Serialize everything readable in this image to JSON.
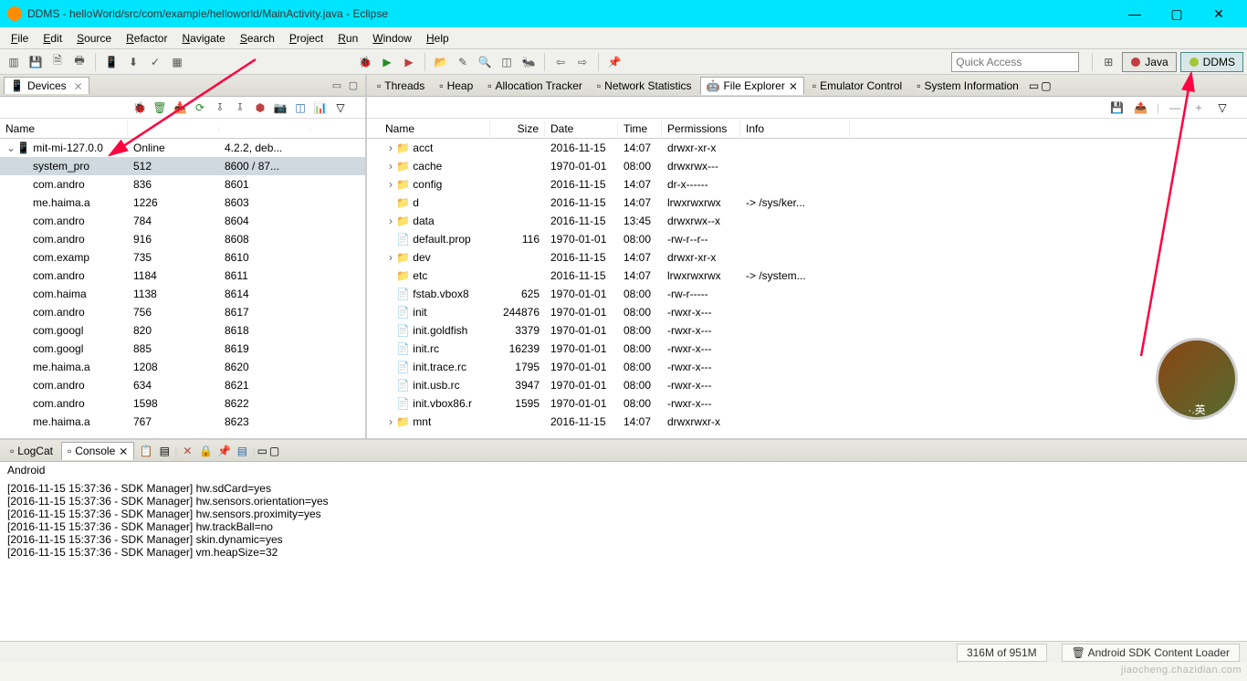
{
  "title": "DDMS - helloWorld/src/com/example/helloworld/MainActivity.java - Eclipse",
  "menus": [
    "File",
    "Edit",
    "Source",
    "Refactor",
    "Navigate",
    "Search",
    "Project",
    "Run",
    "Window",
    "Help"
  ],
  "quick_access_placeholder": "Quick Access",
  "perspectives": {
    "java": "Java",
    "ddms": "DDMS"
  },
  "devices": {
    "tab_label": "Devices",
    "header_name": "Name",
    "root": {
      "name": "mit-mi-127.0.0",
      "status": "Online",
      "version": "4.2.2, deb..."
    },
    "rows": [
      {
        "name": "system_pro",
        "pid": "512",
        "port": "8600 / 87...",
        "sel": true
      },
      {
        "name": "com.andro",
        "pid": "836",
        "port": "8601"
      },
      {
        "name": "me.haima.a",
        "pid": "1226",
        "port": "8603"
      },
      {
        "name": "com.andro",
        "pid": "784",
        "port": "8604"
      },
      {
        "name": "com.andro",
        "pid": "916",
        "port": "8608"
      },
      {
        "name": "com.examp",
        "pid": "735",
        "port": "8610"
      },
      {
        "name": "com.andro",
        "pid": "1184",
        "port": "8611"
      },
      {
        "name": "com.haima",
        "pid": "1138",
        "port": "8614"
      },
      {
        "name": "com.andro",
        "pid": "756",
        "port": "8617"
      },
      {
        "name": "com.googl",
        "pid": "820",
        "port": "8618"
      },
      {
        "name": "com.googl",
        "pid": "885",
        "port": "8619"
      },
      {
        "name": "me.haima.a",
        "pid": "1208",
        "port": "8620"
      },
      {
        "name": "com.andro",
        "pid": "634",
        "port": "8621"
      },
      {
        "name": "com.andro",
        "pid": "1598",
        "port": "8622"
      },
      {
        "name": "me.haima.a",
        "pid": "767",
        "port": "8623"
      }
    ]
  },
  "right_tabs": [
    {
      "label": "Threads"
    },
    {
      "label": "Heap"
    },
    {
      "label": "Allocation Tracker"
    },
    {
      "label": "Network Statistics"
    },
    {
      "label": "File Explorer",
      "active": true
    },
    {
      "label": "Emulator Control"
    },
    {
      "label": "System Information"
    }
  ],
  "file_explorer": {
    "headers": {
      "name": "Name",
      "size": "Size",
      "date": "Date",
      "time": "Time",
      "perm": "Permissions",
      "info": "Info"
    },
    "rows": [
      {
        "exp": ">",
        "type": "folder",
        "name": "acct",
        "size": "",
        "date": "2016-11-15",
        "time": "14:07",
        "perm": "drwxr-xr-x",
        "info": ""
      },
      {
        "exp": ">",
        "type": "folder",
        "name": "cache",
        "size": "",
        "date": "1970-01-01",
        "time": "08:00",
        "perm": "drwxrwx---",
        "info": ""
      },
      {
        "exp": ">",
        "type": "folder",
        "name": "config",
        "size": "",
        "date": "2016-11-15",
        "time": "14:07",
        "perm": "dr-x------",
        "info": ""
      },
      {
        "exp": "",
        "type": "folder",
        "name": "d",
        "size": "",
        "date": "2016-11-15",
        "time": "14:07",
        "perm": "lrwxrwxrwx",
        "info": "-> /sys/ker..."
      },
      {
        "exp": ">",
        "type": "folder",
        "name": "data",
        "size": "",
        "date": "2016-11-15",
        "time": "13:45",
        "perm": "drwxrwx--x",
        "info": ""
      },
      {
        "exp": "",
        "type": "file",
        "name": "default.prop",
        "size": "116",
        "date": "1970-01-01",
        "time": "08:00",
        "perm": "-rw-r--r--",
        "info": ""
      },
      {
        "exp": ">",
        "type": "folder",
        "name": "dev",
        "size": "",
        "date": "2016-11-15",
        "time": "14:07",
        "perm": "drwxr-xr-x",
        "info": ""
      },
      {
        "exp": "",
        "type": "folder",
        "name": "etc",
        "size": "",
        "date": "2016-11-15",
        "time": "14:07",
        "perm": "lrwxrwxrwx",
        "info": "-> /system..."
      },
      {
        "exp": "",
        "type": "file",
        "name": "fstab.vbox8",
        "size": "625",
        "date": "1970-01-01",
        "time": "08:00",
        "perm": "-rw-r-----",
        "info": ""
      },
      {
        "exp": "",
        "type": "file",
        "name": "init",
        "size": "244876",
        "date": "1970-01-01",
        "time": "08:00",
        "perm": "-rwxr-x---",
        "info": ""
      },
      {
        "exp": "",
        "type": "file",
        "name": "init.goldfish",
        "size": "3379",
        "date": "1970-01-01",
        "time": "08:00",
        "perm": "-rwxr-x---",
        "info": ""
      },
      {
        "exp": "",
        "type": "file",
        "name": "init.rc",
        "size": "16239",
        "date": "1970-01-01",
        "time": "08:00",
        "perm": "-rwxr-x---",
        "info": ""
      },
      {
        "exp": "",
        "type": "file",
        "name": "init.trace.rc",
        "size": "1795",
        "date": "1970-01-01",
        "time": "08:00",
        "perm": "-rwxr-x---",
        "info": ""
      },
      {
        "exp": "",
        "type": "file",
        "name": "init.usb.rc",
        "size": "3947",
        "date": "1970-01-01",
        "time": "08:00",
        "perm": "-rwxr-x---",
        "info": ""
      },
      {
        "exp": "",
        "type": "file",
        "name": "init.vbox86.r",
        "size": "1595",
        "date": "1970-01-01",
        "time": "08:00",
        "perm": "-rwxr-x---",
        "info": ""
      },
      {
        "exp": ">",
        "type": "folder",
        "name": "mnt",
        "size": "",
        "date": "2016-11-15",
        "time": "14:07",
        "perm": "drwxrwxr-x",
        "info": ""
      }
    ]
  },
  "console": {
    "tabs": [
      {
        "label": "LogCat"
      },
      {
        "label": "Console",
        "active": true
      }
    ],
    "title": "Android",
    "lines": [
      "[2016-11-15 15:37:36 - SDK Manager] hw.sdCard=yes",
      "[2016-11-15 15:37:36 - SDK Manager] hw.sensors.orientation=yes",
      "[2016-11-15 15:37:36 - SDK Manager] hw.sensors.proximity=yes",
      "[2016-11-15 15:37:36 - SDK Manager] hw.trackBall=no",
      "[2016-11-15 15:37:36 - SDK Manager] skin.dynamic=yes",
      "[2016-11-15 15:37:36 - SDK Manager] vm.heapSize=32"
    ]
  },
  "status": {
    "mem": "316M of 951M",
    "task": "Android SDK Content Loader"
  },
  "avatar_label": "·.英",
  "watermark": "jiaocheng.chazidian.com"
}
